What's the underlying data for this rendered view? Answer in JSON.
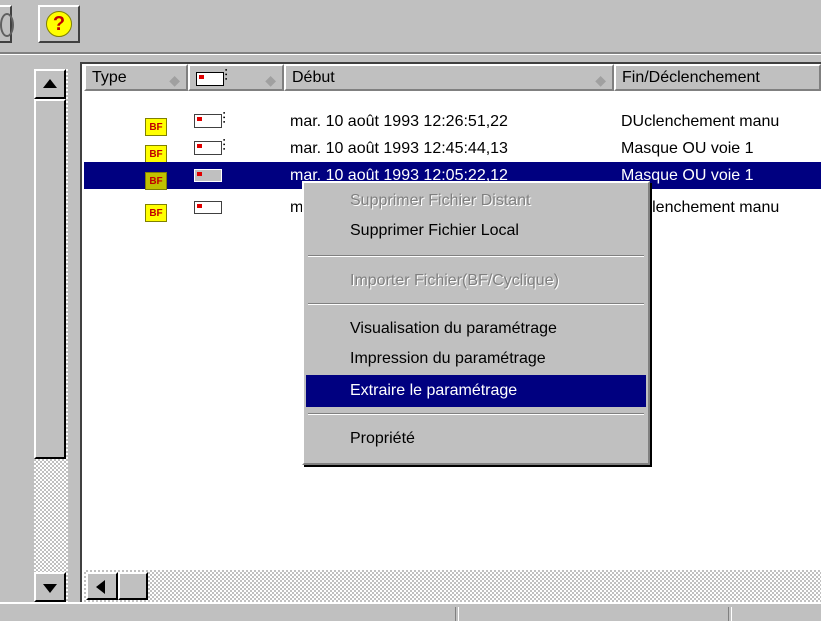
{
  "toolbar": {
    "help_label": "?"
  },
  "columns": {
    "type": "Type",
    "debut": "Début",
    "fin": "Fin/Déclenchement"
  },
  "rows": [
    {
      "badge": "BF",
      "debut": "mar. 10 août  1993 12:26:51,22",
      "fin": "DUclenchement manu"
    },
    {
      "badge": "BF",
      "debut": "mar. 10 août  1993 12:45:44,13",
      "fin": "Masque OU voie 1"
    },
    {
      "badge": "BF",
      "debut": "mar. 10 août  1993 12:05:22,12",
      "fin": "Masque OU voie 1"
    },
    {
      "badge": "BF",
      "debut": "m",
      "fin": "DUclenchement manu"
    }
  ],
  "context_menu": {
    "items": [
      {
        "label": "Supprimer Fichier Distant",
        "enabled": false
      },
      {
        "label": "Supprimer Fichier Local",
        "enabled": true
      },
      {
        "label": "Importer Fichier(BF/Cyclique)",
        "enabled": false
      },
      {
        "label": "Visualisation du paramétrage",
        "enabled": true
      },
      {
        "label": "Impression du paramétrage",
        "enabled": true
      },
      {
        "label": "Extraire le paramétrage",
        "enabled": true,
        "highlighted": true
      },
      {
        "label": "Propriété",
        "enabled": true
      }
    ]
  },
  "colors": {
    "selection": "#000080",
    "face": "#c0c0c0",
    "badge_bg": "#ffff00"
  }
}
